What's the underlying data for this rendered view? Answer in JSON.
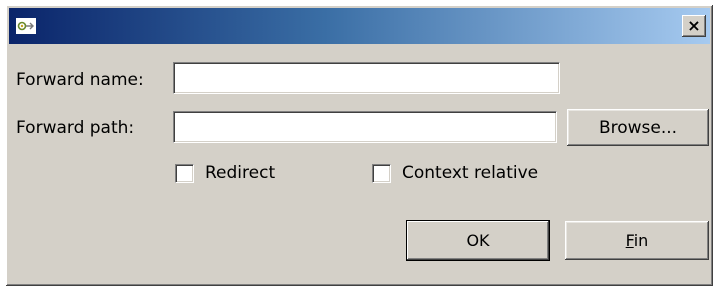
{
  "window": {
    "title": "",
    "icon": "plugin-icon",
    "close_label": "×"
  },
  "form": {
    "forward_name_label": "Forward name:",
    "forward_name_value": "",
    "forward_path_label": "Forward path:",
    "forward_path_value": "",
    "browse_label": "Browse...",
    "redirect_label": "Redirect",
    "redirect_checked": false,
    "context_relative_label": "Context relative",
    "context_relative_checked": false
  },
  "buttons": {
    "ok_label": "OK",
    "fin_mnemonic": "F",
    "fin_rest": "in"
  }
}
